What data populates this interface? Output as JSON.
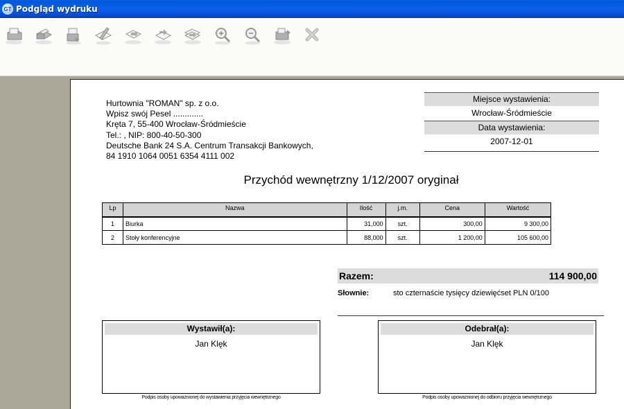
{
  "window": {
    "title": "Podgląd wydruku",
    "icon": "app-icon"
  },
  "toolbar": {
    "buttons": [
      {
        "name": "print-icon"
      },
      {
        "name": "print-setup-icon"
      },
      {
        "name": "printer-options-icon"
      },
      {
        "name": "edit-icon"
      },
      {
        "name": "first-page-icon"
      },
      {
        "name": "previous-page-icon"
      },
      {
        "name": "next-page-icon"
      },
      {
        "name": "zoom-in-icon"
      },
      {
        "name": "zoom-out-icon"
      },
      {
        "name": "export-icon"
      },
      {
        "name": "close-icon"
      }
    ]
  },
  "document": {
    "seller": {
      "line1": "Hurtownia \"ROMAN\" sp. z o.o.",
      "line2": "Wpisz swój Pesel .............",
      "line3": "Kręta 7, 55-400 Wrocław-Śródmieście",
      "line4": "Tel.: , NIP: 800-40-50-300",
      "line5": "Deutsche Bank 24 S.A. Centrum Transakcji Bankowych,",
      "line6": "84 1910 1064 0051 6354 4111 002"
    },
    "issue_place_label": "Miejsce wystawienia:",
    "issue_place": "Wrocław-Śródmieście",
    "issue_date_label": "Data wystawienia:",
    "issue_date": "2007-12-01",
    "title": "Przychód wewnętrzny  1/12/2007 oryginał",
    "table": {
      "headers": {
        "lp": "Lp",
        "name": "Nazwa",
        "qty": "Ilość",
        "unit": "j.m.",
        "price": "Cena",
        "value": "Wartość"
      },
      "rows": [
        {
          "lp": "1",
          "name": "Biurka",
          "qty": "31,000",
          "unit": "szt.",
          "price": "300,00",
          "value": "9 300,00"
        },
        {
          "lp": "2",
          "name": "Stoły konferencyjne",
          "qty": "88,000",
          "unit": "szt.",
          "price": "1 200,00",
          "value": "105 600,00"
        }
      ]
    },
    "total_label": "Razem:",
    "total_value": "114 900,00",
    "words_label": "Słownie:",
    "words_value": "sto czternaście tysięcy dziewięćset  PLN  0/100",
    "issued_by_label": "Wystawił(a):",
    "issued_by_name": "Jan Klęk",
    "issued_by_caption": "Podpis osoby upoważnionej do wystawienia przyjęcia wewnętrznego",
    "received_by_label": "Odebrał(a):",
    "received_by_name": "Jan Klęk",
    "received_by_caption": "Podpis osoby upoważnionej do odbioru przyjęcia wewnętrznego"
  }
}
